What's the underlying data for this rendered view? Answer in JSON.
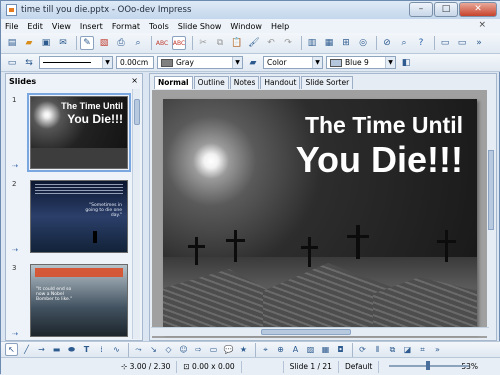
{
  "window": {
    "title": "time till you die.pptx - OOo-dev Impress"
  },
  "menu": {
    "items": [
      "File",
      "Edit",
      "View",
      "Insert",
      "Format",
      "Tools",
      "Slide Show",
      "Window",
      "Help"
    ],
    "close": "×"
  },
  "toolbar_line": {
    "line_width": "0.00cm",
    "fill_type": "Gray",
    "area_style": "Color",
    "fill_color": "Blue 9",
    "colors": {
      "gray": "#808080",
      "blue9": "#b4c7dc"
    }
  },
  "slides_panel": {
    "title": "Slides",
    "close": "×",
    "thumbs": [
      {
        "number": "1",
        "title_line1": "The Time Until",
        "title_line2": "You Die!!!"
      },
      {
        "number": "2",
        "text": "\"Sometimes in going to die one day.\""
      },
      {
        "number": "3",
        "text": "\"It could end so now a Nobel Bomber to like.\""
      }
    ]
  },
  "editor": {
    "tabs": [
      "Normal",
      "Outline",
      "Notes",
      "Handout",
      "Slide Sorter"
    ],
    "active_tab": "Normal",
    "slide": {
      "title_line1": "The Time Until",
      "title_line2": "You Die!!!"
    }
  },
  "statusbar": {
    "position": "3.00 / 2.30",
    "size": "0.00 x 0.00",
    "slide": "Slide 1 / 21",
    "layout": "Default",
    "zoom": "53%"
  }
}
